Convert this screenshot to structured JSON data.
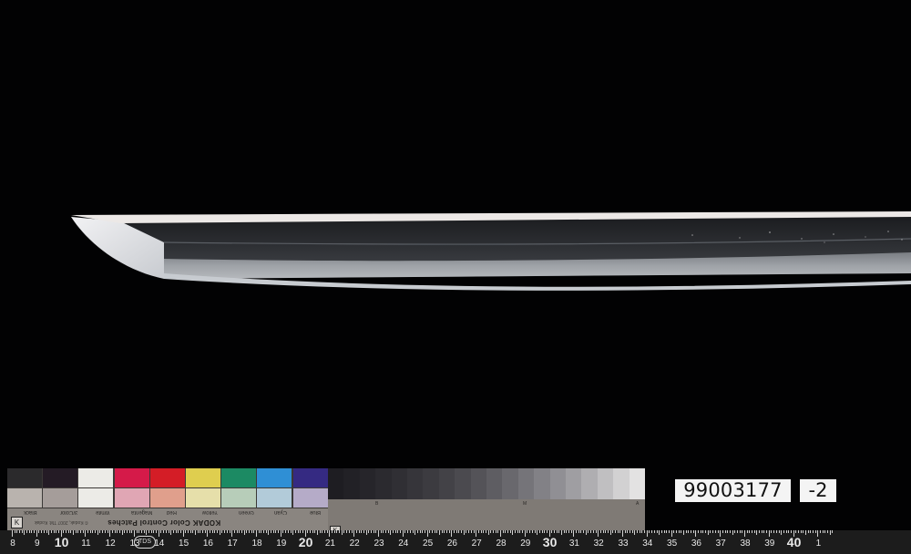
{
  "photo": {
    "background_color": "#020203",
    "blade_edge_color": "#ece8e6",
    "blade_body_color": "#333538"
  },
  "color_card": {
    "title": "KODAK Color Control Patches",
    "subtitle": "© Kodak, 2007 TM: Kodak",
    "patch_labels": [
      "Blue",
      "Cyan",
      "Green",
      "Yellow",
      "Red",
      "Magenta",
      "White",
      "3/Color",
      "Black"
    ],
    "top_row_colors": [
      "#2b2a2c",
      "#241b25",
      "#ecebe7",
      "#d51a49",
      "#d41d26",
      "#dfce4f",
      "#1c8a63",
      "#2f8fd5",
      "#352a82"
    ],
    "bottom_row_colors": [
      "#b9b3ae",
      "#a59d9a",
      "#ecebe7",
      "#e0a6b4",
      "#e09f8c",
      "#e6dfaa",
      "#b7cdb9",
      "#b2cbd9",
      "#b5abc8"
    ]
  },
  "gray_scale": {
    "steps": [
      "#1e1d22",
      "#222126",
      "#26252a",
      "#2b2a2f",
      "#302f34",
      "#36353a",
      "#3c3b40",
      "#434247",
      "#4b4a4f",
      "#545358",
      "#5e5d62",
      "#69686d",
      "#757479",
      "#828186",
      "#908f94",
      "#9f9ea2",
      "#afaeb1",
      "#c0bfc1",
      "#d2d1d2",
      "#e3e2e2"
    ],
    "labels": [
      "B",
      "M",
      "A"
    ]
  },
  "specimen": {
    "id_number": "99003177",
    "suffix": "-2"
  },
  "ruler": {
    "labels": [
      "8",
      "9",
      "10",
      "11",
      "12",
      "13",
      "14",
      "15",
      "16",
      "17",
      "18",
      "19",
      "20",
      "21",
      "22",
      "23",
      "24",
      "25",
      "26",
      "27",
      "28",
      "29",
      "30",
      "31",
      "32",
      "33",
      "34",
      "35",
      "36",
      "37",
      "38",
      "39",
      "40",
      "1"
    ],
    "badge": "TDS"
  }
}
